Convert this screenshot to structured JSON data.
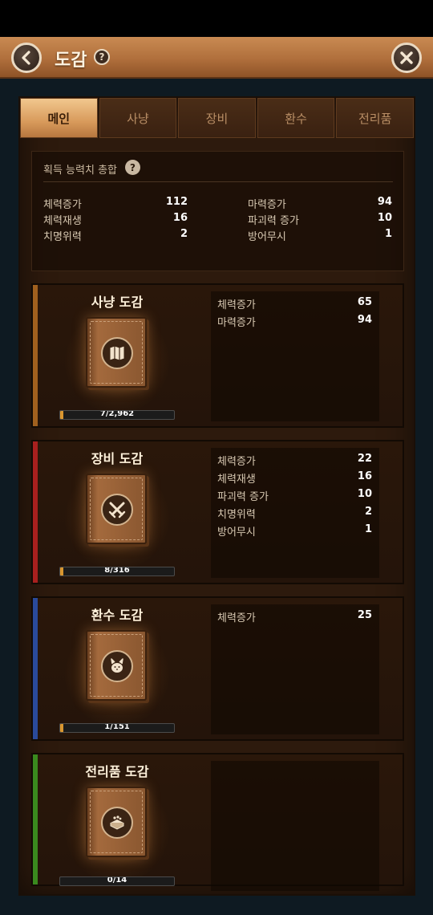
{
  "header": {
    "title": "도감",
    "help_icon": "?"
  },
  "tabs": [
    {
      "label": "메인",
      "active": true
    },
    {
      "label": "사냥",
      "active": false
    },
    {
      "label": "장비",
      "active": false
    },
    {
      "label": "환수",
      "active": false
    },
    {
      "label": "전리품",
      "active": false
    }
  ],
  "summary": {
    "title": "획득 능력치 총합",
    "help_icon": "?",
    "left": [
      {
        "label": "체력증가",
        "value": "112"
      },
      {
        "label": "체력재생",
        "value": "16"
      },
      {
        "label": "치명위력",
        "value": "2"
      }
    ],
    "right": [
      {
        "label": "마력증가",
        "value": "94"
      },
      {
        "label": "파괴력 증가",
        "value": "10"
      },
      {
        "label": "방어무시",
        "value": "1"
      }
    ]
  },
  "cards": [
    {
      "title": "사냥 도감",
      "accent": "#a0601e",
      "emblem": "map-icon",
      "progress_text": "7/2,962",
      "progress_fraction": 0.002,
      "stats": [
        {
          "label": "체력증가",
          "value": "65"
        },
        {
          "label": "마력증가",
          "value": "94"
        }
      ]
    },
    {
      "title": "장비 도감",
      "accent": "#a8201e",
      "emblem": "crossed-swords-icon",
      "progress_text": "8/316",
      "progress_fraction": 0.025,
      "stats": [
        {
          "label": "체력증가",
          "value": "22"
        },
        {
          "label": "체력재생",
          "value": "16"
        },
        {
          "label": "파괴력 증가",
          "value": "10"
        },
        {
          "label": "치명위력",
          "value": "2"
        },
        {
          "label": "방어무시",
          "value": "1"
        }
      ]
    },
    {
      "title": "환수 도감",
      "accent": "#2a4a9a",
      "emblem": "squirrel-icon",
      "progress_text": "1/151",
      "progress_fraction": 0.007,
      "stats": [
        {
          "label": "체력증가",
          "value": "25"
        }
      ]
    },
    {
      "title": "전리품 도감",
      "accent": "#3a8a1e",
      "emblem": "treasure-icon",
      "progress_text": "0/14",
      "progress_fraction": 0,
      "stats": []
    }
  ]
}
